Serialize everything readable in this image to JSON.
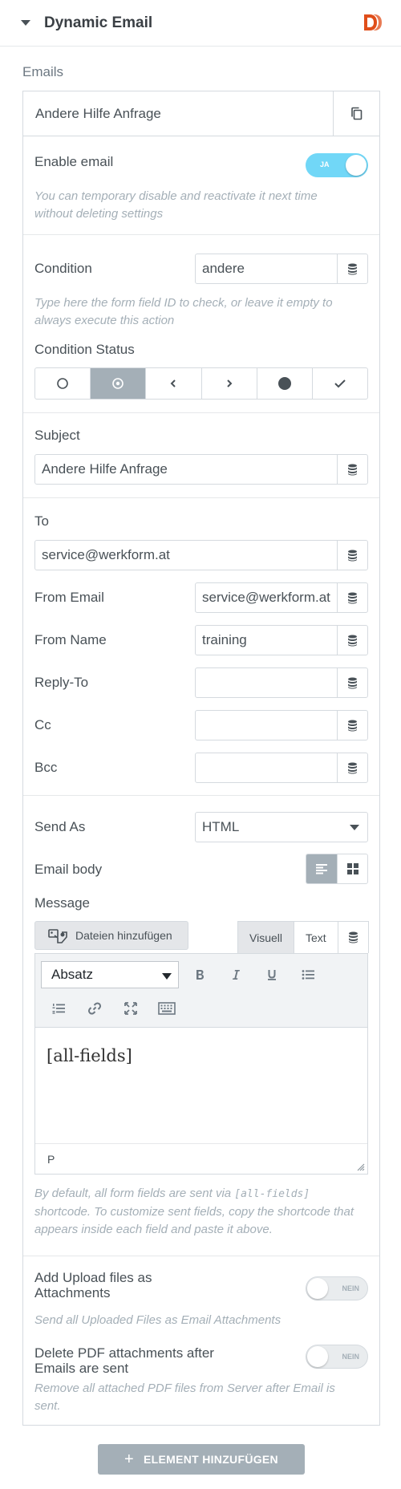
{
  "section": {
    "title": "Dynamic Email",
    "logo_color": "#e04e1a"
  },
  "emails_label": "Emails",
  "item": {
    "title": "Andere Hilfe Anfrage"
  },
  "enable_email": {
    "label": "Enable email",
    "toggle_label": "JA",
    "on": true,
    "hint": "You can temporary disable and reactivate it next time without deleting settings"
  },
  "condition": {
    "label": "Condition",
    "value": "andere",
    "hint": "Type here the form field ID to check, or leave it empty to always execute this action"
  },
  "condition_status": {
    "label": "Condition Status",
    "options": [
      "empty-circle-icon",
      "dot-circle-icon",
      "chevron-left-icon",
      "chevron-right-icon",
      "filled-circle-icon",
      "check-icon"
    ],
    "selected_index": 1
  },
  "subject": {
    "label": "Subject",
    "value": "Andere Hilfe Anfrage"
  },
  "to": {
    "label": "To",
    "value": "service@werkform.at"
  },
  "from_email": {
    "label": "From Email",
    "value": "service@werkform.at"
  },
  "from_name": {
    "label": "From Name",
    "value": "training"
  },
  "reply_to": {
    "label": "Reply-To",
    "value": ""
  },
  "cc": {
    "label": "Cc",
    "value": ""
  },
  "bcc": {
    "label": "Bcc",
    "value": ""
  },
  "send_as": {
    "label": "Send As",
    "value": "HTML"
  },
  "email_body": {
    "label": "Email body",
    "selected": "text-align-icon"
  },
  "message": {
    "label": "Message",
    "media_button": "Dateien hinzufügen",
    "tabs": [
      "Visuell",
      "Text"
    ],
    "active_tab": "Visuell",
    "format": "Absatz",
    "content": "[all-fields]",
    "status_path": "P"
  },
  "message_hint": {
    "part1": "By default, all form fields are sent via ",
    "code": "[all-fields]",
    "part2": " shortcode. To customize sent fields, copy the shortcode that appears inside each field and paste it above."
  },
  "upload_attachments": {
    "label": "Add Upload files as Attachments",
    "toggle_label": "NEIN",
    "on": false,
    "hint": "Send all Uploaded Files as Email Attachments"
  },
  "delete_pdf": {
    "label": "Delete PDF attachments after Emails are sent",
    "toggle_label": "NEIN",
    "on": false,
    "hint": "Remove all attached PDF files from Server after Email is sent."
  },
  "add_element_button": "ELEMENT HINZUFÜGEN",
  "colors": {
    "toggle_on": "#71d7f7",
    "active_control": "#a4afb7",
    "hint_text": "#a4afb7"
  }
}
